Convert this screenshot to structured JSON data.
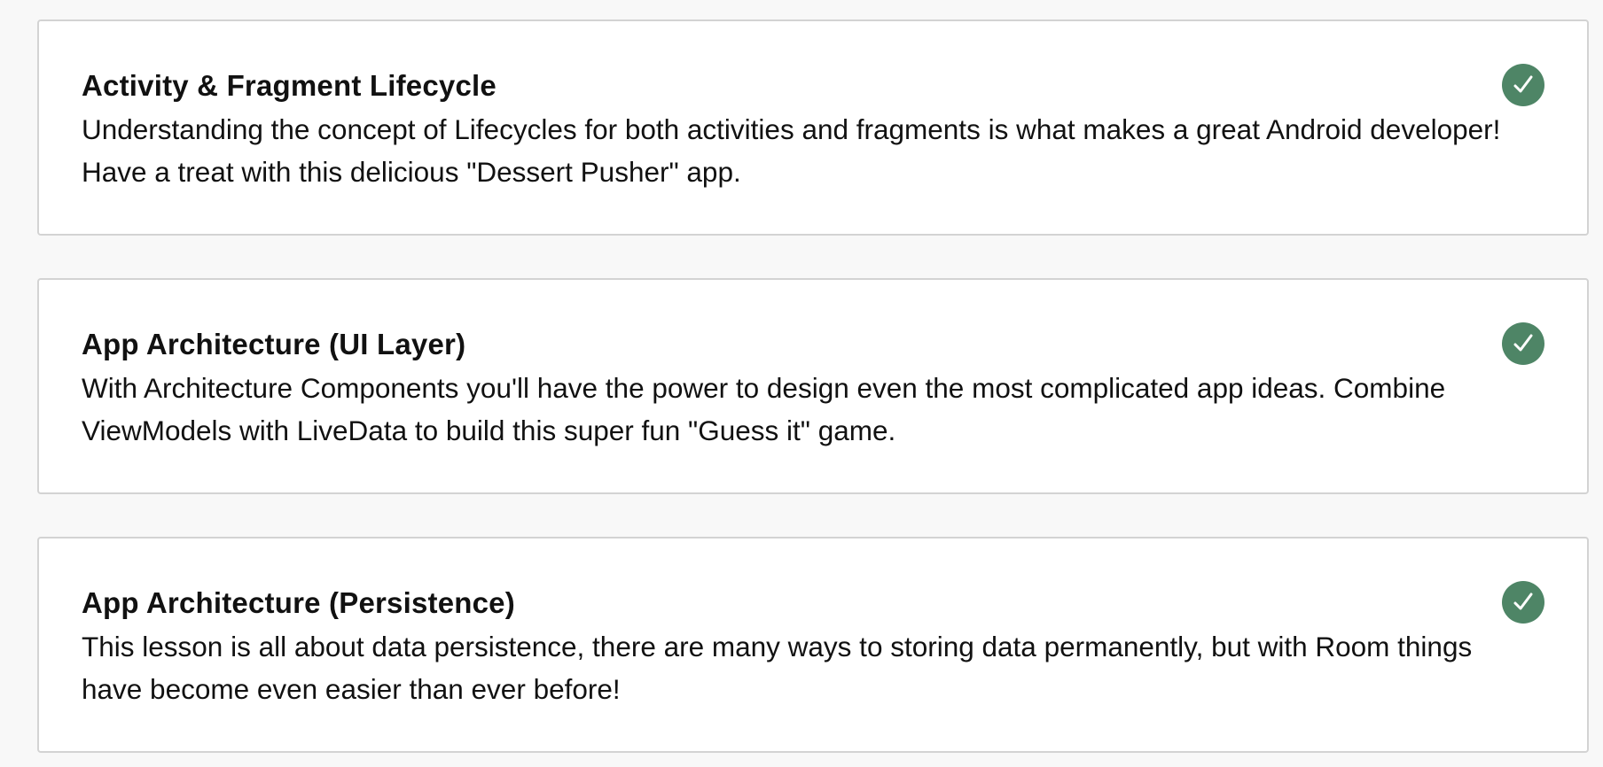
{
  "lessons": [
    {
      "title": "Activity & Fragment Lifecycle",
      "description": "Understanding the concept of Lifecycles for both activities and fragments is what makes a great Android developer! Have a treat with this delicious \"Dessert Pusher\" app.",
      "status_icon": "checkmark-icon"
    },
    {
      "title": "App Architecture (UI Layer)",
      "description": "With Architecture Components you'll have the power to design even the most complicated app ideas. Combine ViewModels with LiveData to build this super fun \"Guess it\" game.",
      "status_icon": "checkmark-icon"
    },
    {
      "title": "App Architecture (Persistence)",
      "description": "This lesson is all about data persistence, there are many ways to storing data permanently, but with Room things have become even easier than ever before!",
      "status_icon": "checkmark-icon"
    }
  ],
  "colors": {
    "page_background": "#f8f8f8",
    "card_background": "#ffffff",
    "card_border": "#d3d3d3",
    "complete_badge": "#4e8566",
    "text": "#111111"
  }
}
